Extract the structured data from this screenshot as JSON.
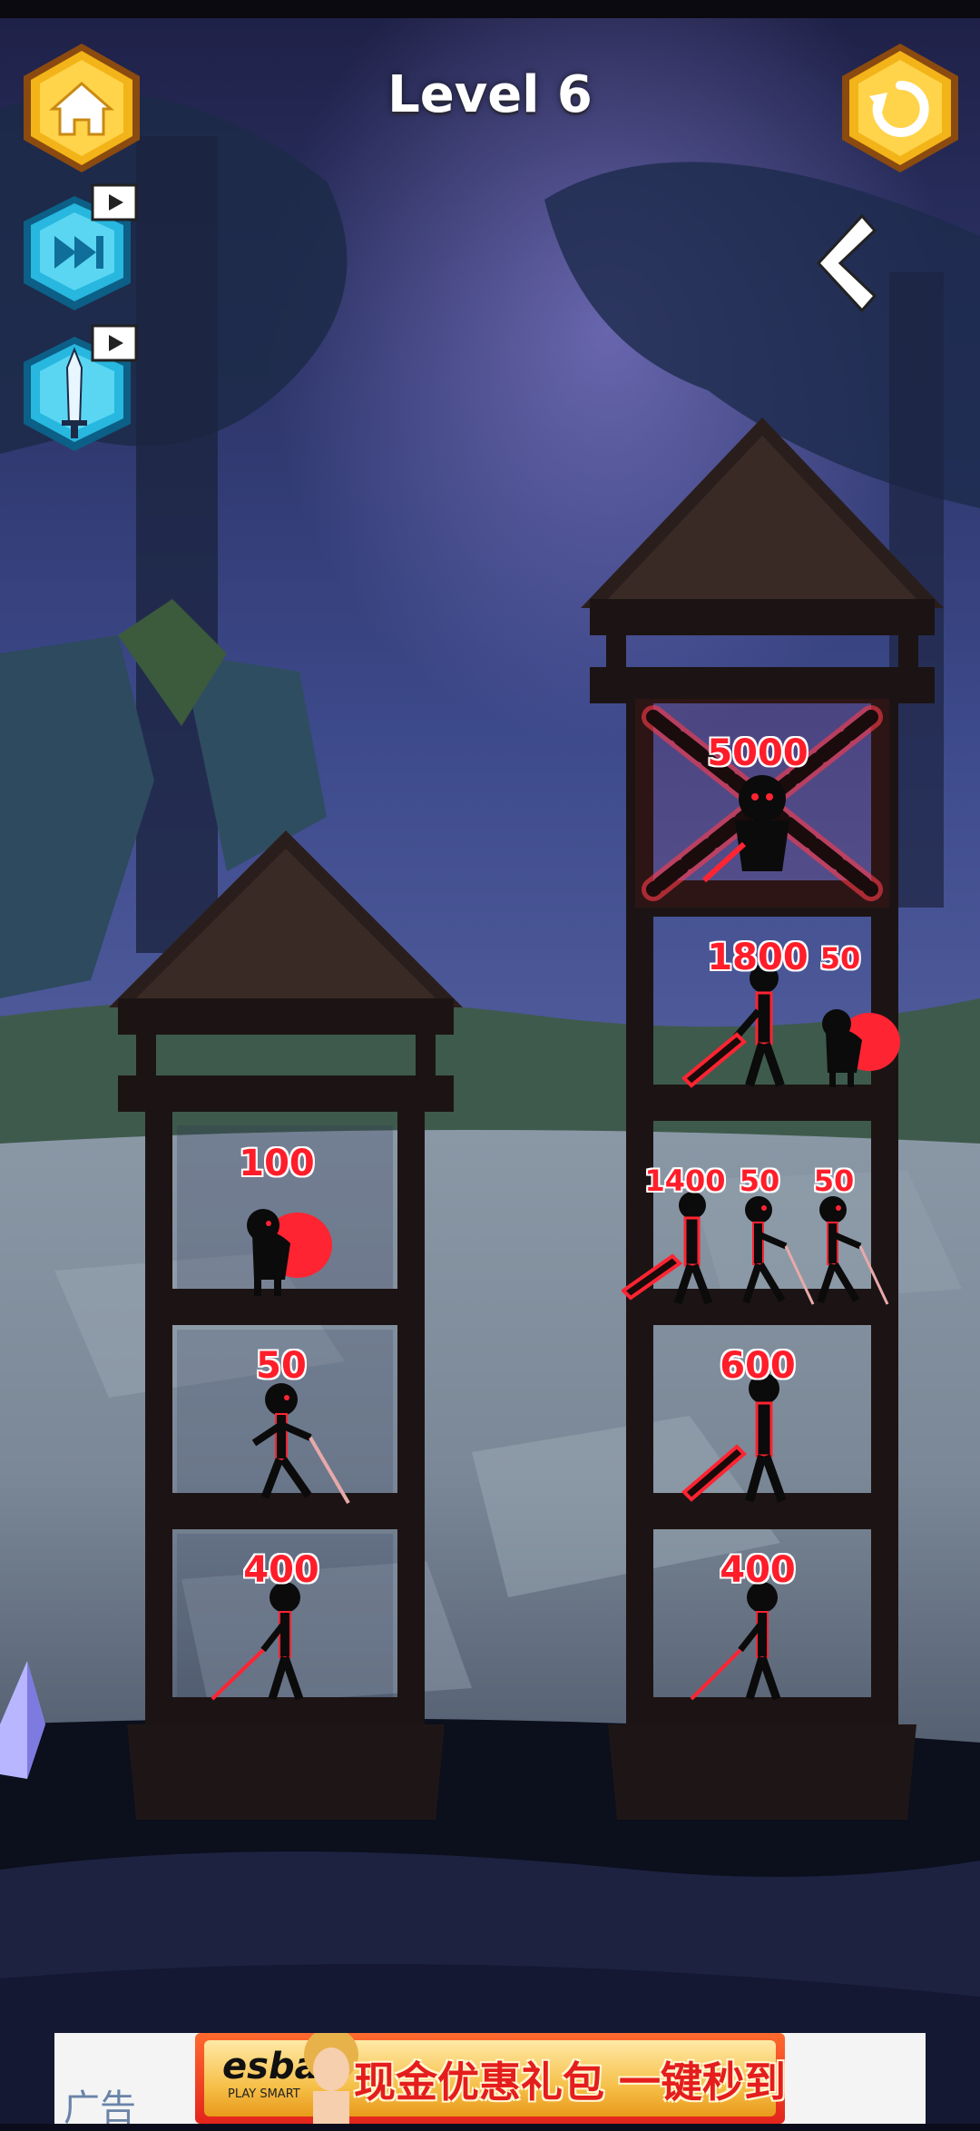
{
  "header": {
    "level_title": "Level 6",
    "home_icon": "home-icon",
    "restart_icon": "restart-icon",
    "back_icon": "chevron-left-icon"
  },
  "skills": [
    {
      "name": "skip-level",
      "icon": "fast-forward-icon",
      "badge": "video-ad-icon"
    },
    {
      "name": "sword-boost",
      "icon": "sword-icon",
      "badge": "video-ad-icon"
    }
  ],
  "player_tower": {
    "rooms": [
      {
        "units": [
          {
            "kind": "hooded-cape",
            "power": "100"
          }
        ]
      },
      {
        "units": [
          {
            "kind": "spearman",
            "power": "50"
          }
        ]
      },
      {
        "units": [
          {
            "kind": "swordsman",
            "power": "400"
          }
        ]
      }
    ]
  },
  "enemy_tower": {
    "rooms": [
      {
        "locked": true,
        "units": [
          {
            "kind": "boss",
            "power": "5000"
          }
        ]
      },
      {
        "units": [
          {
            "kind": "greatsword",
            "power": "1800"
          },
          {
            "kind": "hooded-cape",
            "power": "50"
          }
        ]
      },
      {
        "units": [
          {
            "kind": "greatsword",
            "power": "1400"
          },
          {
            "kind": "spearman",
            "power": "50"
          },
          {
            "kind": "spearman",
            "power": "50"
          }
        ]
      },
      {
        "units": [
          {
            "kind": "greatsword",
            "power": "600"
          }
        ]
      },
      {
        "units": [
          {
            "kind": "swordsman",
            "power": "400"
          }
        ]
      }
    ]
  },
  "ad": {
    "label": "广告",
    "brand": "esball",
    "brand_sub": "PLAY SMART",
    "slogan": "现金优惠礼包 一键秒到帐"
  },
  "colors": {
    "power_text": "#ff1d2a",
    "wood_dark": "#1c1414",
    "button_gold": "#f2b418",
    "button_blue": "#27b7df"
  }
}
